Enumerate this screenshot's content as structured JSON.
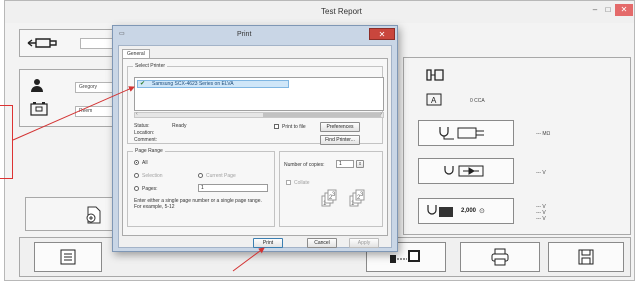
{
  "app": {
    "title": "Test Report",
    "window_controls": {
      "minimize": "–",
      "maximize": "□",
      "close": "✕"
    },
    "fields": {
      "name_value": "Gregory",
      "battery_value": "Reem",
      "cca_value": "0 CCA",
      "resistance_value": "--- MΩ",
      "diode_value": "--- V",
      "ripple_values": [
        "--- V",
        "--- V",
        "--- V"
      ],
      "rpm_value": "2,000"
    }
  },
  "dialog": {
    "title": "Print",
    "tab_general": "General",
    "select_printer_label": "Select Printer",
    "printer_name": "Samsung SCX-4623 Series on ELVA",
    "status_label": "Status:",
    "status_value": "Ready",
    "location_label": "Location:",
    "comment_label": "Comment:",
    "print_to_file_label": "Print to file",
    "preferences_button": "Preferences",
    "find_printer_button": "Find Printer...",
    "page_range_label": "Page Range",
    "range_all": "All",
    "range_selection": "Selection",
    "range_current_page": "Current Page",
    "range_pages": "Pages:",
    "pages_value": "1",
    "pages_hint": "Enter either a single page number or a single page range. For example, 5-12",
    "copies_label": "Number of copies:",
    "copies_value": "1",
    "collate_label": "Collate",
    "print_button": "Print",
    "cancel_button": "Cancel",
    "apply_button": "Apply"
  },
  "colors": {
    "annotation_red": "#d33333",
    "dialog_frame": "#c9d6e6",
    "selection_blue": "#cfe6f8"
  }
}
